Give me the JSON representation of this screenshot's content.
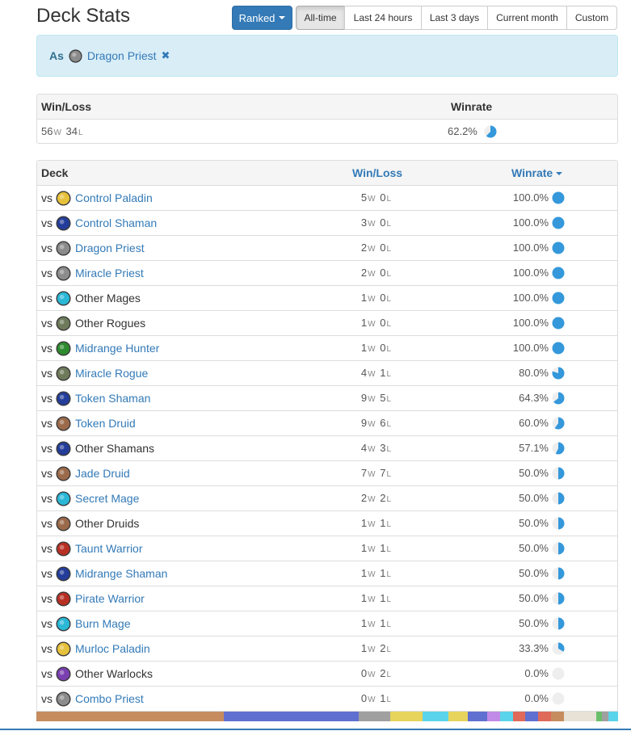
{
  "header": {
    "title": "Deck Stats",
    "mode_label": "Ranked",
    "time_ranges": [
      {
        "label": "All-time",
        "active": true
      },
      {
        "label": "Last 24 hours",
        "active": false
      },
      {
        "label": "Last 3 days",
        "active": false
      },
      {
        "label": "Current month",
        "active": false
      },
      {
        "label": "Custom",
        "active": false
      }
    ]
  },
  "filter": {
    "as_label": "As",
    "deck_name": "Dragon Priest",
    "class": "priest"
  },
  "summary": {
    "headers": {
      "winloss": "Win/Loss",
      "winrate": "Winrate"
    },
    "wins": "56",
    "losses": "34",
    "winrate_text": "62.2%",
    "winrate": 62.2
  },
  "units": {
    "w": "W",
    "l": "L",
    "vs": "vs"
  },
  "matchups": {
    "headers": {
      "deck": "Deck",
      "winloss": "Win/Loss",
      "winrate": "Winrate"
    },
    "rows": [
      {
        "deck": "Control Paladin",
        "class": "paladin",
        "link": true,
        "wins": "5",
        "losses": "0",
        "winrate_text": "100.0%",
        "winrate": 100
      },
      {
        "deck": "Control Shaman",
        "class": "shaman",
        "link": true,
        "wins": "3",
        "losses": "0",
        "winrate_text": "100.0%",
        "winrate": 100
      },
      {
        "deck": "Dragon Priest",
        "class": "priest",
        "link": true,
        "wins": "2",
        "losses": "0",
        "winrate_text": "100.0%",
        "winrate": 100
      },
      {
        "deck": "Miracle Priest",
        "class": "priest",
        "link": true,
        "wins": "2",
        "losses": "0",
        "winrate_text": "100.0%",
        "winrate": 100
      },
      {
        "deck": "Other Mages",
        "class": "mage",
        "link": false,
        "wins": "1",
        "losses": "0",
        "winrate_text": "100.0%",
        "winrate": 100
      },
      {
        "deck": "Other Rogues",
        "class": "rogue",
        "link": false,
        "wins": "1",
        "losses": "0",
        "winrate_text": "100.0%",
        "winrate": 100
      },
      {
        "deck": "Midrange Hunter",
        "class": "hunter",
        "link": true,
        "wins": "1",
        "losses": "0",
        "winrate_text": "100.0%",
        "winrate": 100
      },
      {
        "deck": "Miracle Rogue",
        "class": "rogue",
        "link": true,
        "wins": "4",
        "losses": "1",
        "winrate_text": "80.0%",
        "winrate": 80
      },
      {
        "deck": "Token Shaman",
        "class": "shaman",
        "link": true,
        "wins": "9",
        "losses": "5",
        "winrate_text": "64.3%",
        "winrate": 64.3
      },
      {
        "deck": "Token Druid",
        "class": "druid",
        "link": true,
        "wins": "9",
        "losses": "6",
        "winrate_text": "60.0%",
        "winrate": 60
      },
      {
        "deck": "Other Shamans",
        "class": "shaman",
        "link": false,
        "wins": "4",
        "losses": "3",
        "winrate_text": "57.1%",
        "winrate": 57.1
      },
      {
        "deck": "Jade Druid",
        "class": "druid",
        "link": true,
        "wins": "7",
        "losses": "7",
        "winrate_text": "50.0%",
        "winrate": 50
      },
      {
        "deck": "Secret Mage",
        "class": "mage",
        "link": true,
        "wins": "2",
        "losses": "2",
        "winrate_text": "50.0%",
        "winrate": 50
      },
      {
        "deck": "Other Druids",
        "class": "druid",
        "link": false,
        "wins": "1",
        "losses": "1",
        "winrate_text": "50.0%",
        "winrate": 50
      },
      {
        "deck": "Taunt Warrior",
        "class": "warrior",
        "link": true,
        "wins": "1",
        "losses": "1",
        "winrate_text": "50.0%",
        "winrate": 50
      },
      {
        "deck": "Midrange Shaman",
        "class": "shaman",
        "link": true,
        "wins": "1",
        "losses": "1",
        "winrate_text": "50.0%",
        "winrate": 50
      },
      {
        "deck": "Pirate Warrior",
        "class": "warrior",
        "link": true,
        "wins": "1",
        "losses": "1",
        "winrate_text": "50.0%",
        "winrate": 50
      },
      {
        "deck": "Burn Mage",
        "class": "mage",
        "link": true,
        "wins": "1",
        "losses": "1",
        "winrate_text": "50.0%",
        "winrate": 50
      },
      {
        "deck": "Murloc Paladin",
        "class": "paladin",
        "link": true,
        "wins": "1",
        "losses": "2",
        "winrate_text": "33.3%",
        "winrate": 33.3
      },
      {
        "deck": "Other Warlocks",
        "class": "warlock",
        "link": false,
        "wins": "0",
        "losses": "2",
        "winrate_text": "0.0%",
        "winrate": 0
      },
      {
        "deck": "Combo Priest",
        "class": "priest",
        "link": true,
        "wins": "0",
        "losses": "1",
        "winrate_text": "0.0%",
        "winrate": 0
      }
    ]
  },
  "class_colors": {
    "paladin": "#e6c13b",
    "shaman": "#243d9a",
    "priest": "#8c8c8c",
    "mage": "#2bb7d6",
    "rogue": "#6e7a5a",
    "hunter": "#2e8a2e",
    "druid": "#9b6a4b",
    "warrior": "#b83024",
    "warlock": "#7a3fb0"
  },
  "colors": {
    "link": "#337ab7",
    "pie_fill": "#3498db",
    "pie_empty": "#eeeeee"
  },
  "distribution_bar": [
    {
      "color": "#c68c5e",
      "fraction": 0.322
    },
    {
      "color": "#5f70d0",
      "fraction": 0.232
    },
    {
      "color": "#a0a0a0",
      "fraction": 0.055
    },
    {
      "color": "#e6d45c",
      "fraction": 0.055
    },
    {
      "color": "#5ad4ea",
      "fraction": 0.045
    },
    {
      "color": "#e6d45c",
      "fraction": 0.033
    },
    {
      "color": "#5f70d0",
      "fraction": 0.033
    },
    {
      "color": "#c08ae6",
      "fraction": 0.022
    },
    {
      "color": "#5ad4ea",
      "fraction": 0.022
    },
    {
      "color": "#e06a5a",
      "fraction": 0.022
    },
    {
      "color": "#5f70d0",
      "fraction": 0.022
    },
    {
      "color": "#e06a5a",
      "fraction": 0.022
    },
    {
      "color": "#c68c5e",
      "fraction": 0.022
    },
    {
      "color": "#e8e2d6",
      "fraction": 0.055
    },
    {
      "color": "#6abf6a",
      "fraction": 0.011
    },
    {
      "color": "#a0a0a0",
      "fraction": 0.011
    },
    {
      "color": "#5ad4ea",
      "fraction": 0.016
    }
  ]
}
